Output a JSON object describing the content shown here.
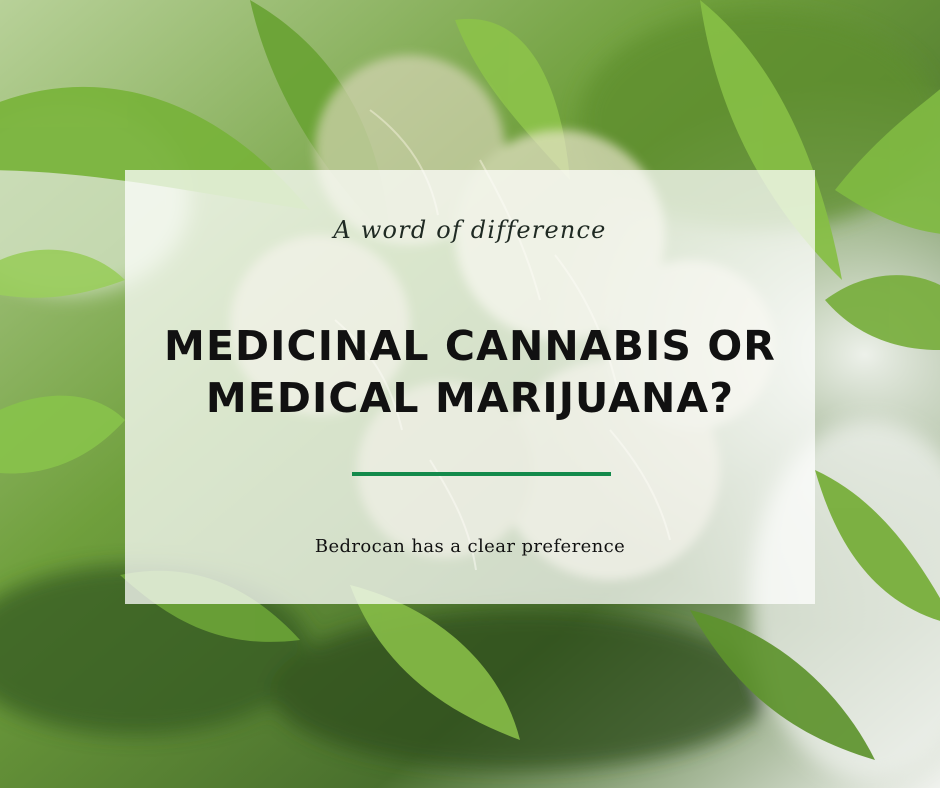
{
  "content": {
    "eyebrow": "A word of difference",
    "headline_line1": "MEDICINAL CANNABIS OR",
    "headline_line2": "MEDICAL MARIJUANA?",
    "subline": "Bedrocan has a clear preference"
  },
  "colors": {
    "accent": "#138a4b",
    "text": "#111111",
    "card": "#ffffffbc"
  }
}
